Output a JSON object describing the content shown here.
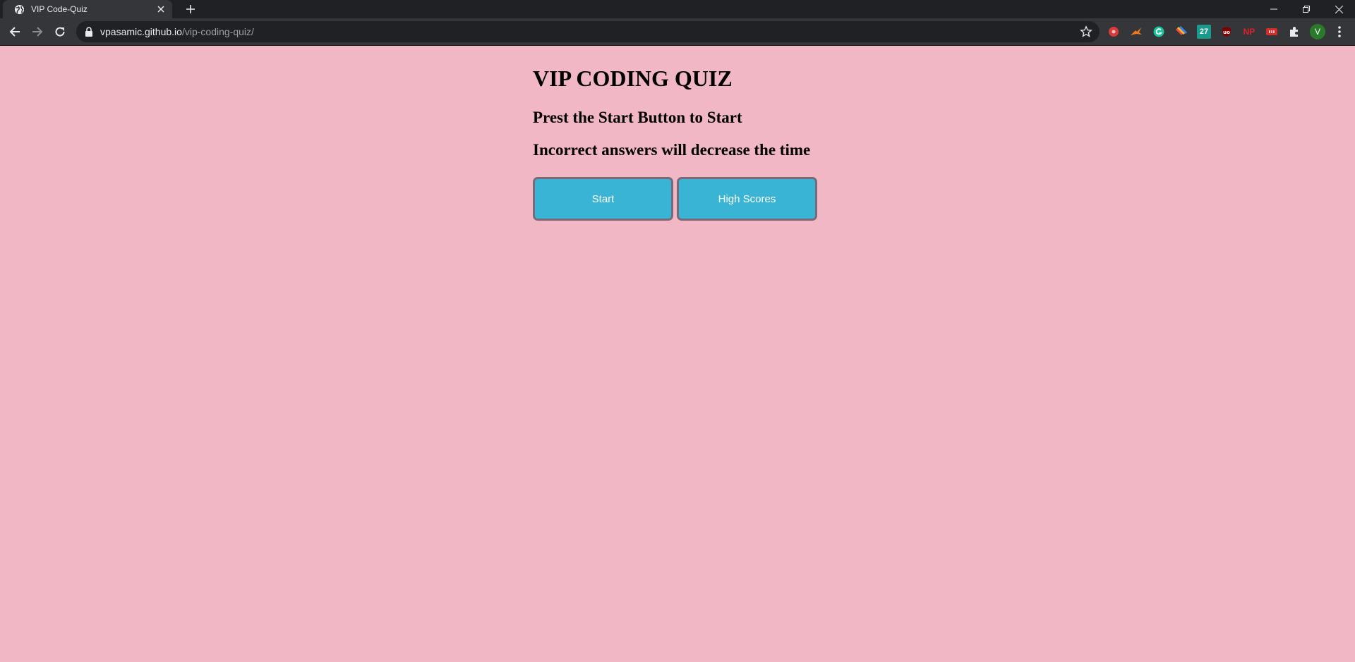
{
  "browser": {
    "tab_title": "VIP Code-Quiz",
    "url_host": "vpasamic.github.io",
    "url_path": "/vip-coding-quiz/",
    "profile_initial": "V",
    "extensions": [
      "record-icon",
      "fox-icon",
      "grammarly-icon",
      "colorful-icon",
      "calendar-27-icon",
      "ublock-icon",
      "np-icon",
      "ticket-icon",
      "puzzle-icon"
    ],
    "ext_calendar_text": "27",
    "ext_np_text": "NP"
  },
  "page": {
    "title": "VIP CODING QUIZ",
    "instruction_1": "Prest the Start Button to Start",
    "instruction_2": "Incorrect answers will decrease the time",
    "start_label": "Start",
    "highscores_label": "High Scores"
  },
  "colors": {
    "background": "#f1b7c5",
    "button": "#39b4d5",
    "button_border": "#7a6a78"
  }
}
